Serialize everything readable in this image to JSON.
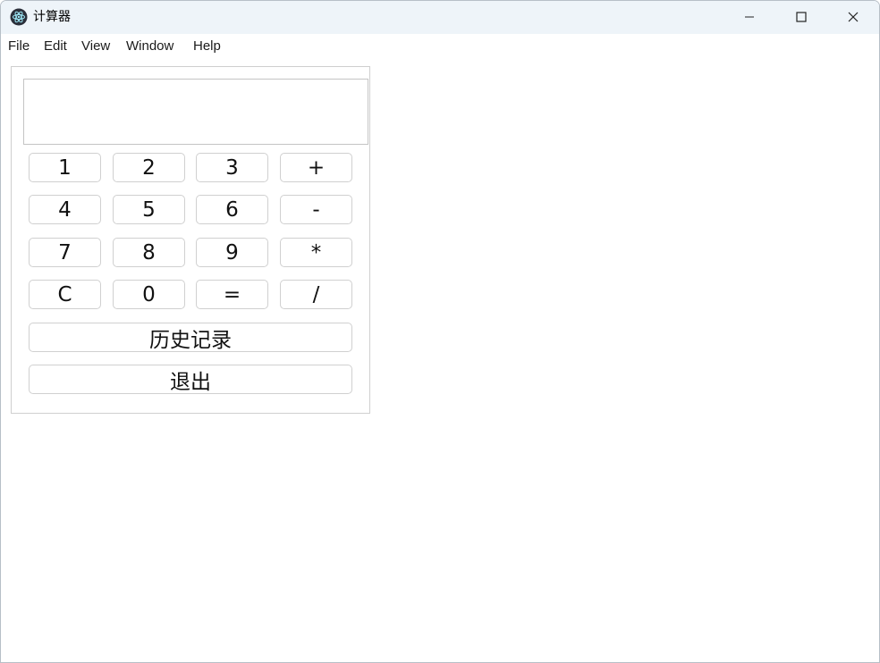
{
  "window": {
    "title": "计算器",
    "app_icon": "electron-atom-icon",
    "controls": {
      "minimize_icon": "minimize-icon",
      "maximize_icon": "maximize-icon",
      "close_icon": "close-icon"
    }
  },
  "menu": {
    "items": [
      "File",
      "Edit",
      "View",
      "Window",
      "Help"
    ]
  },
  "calculator": {
    "display_value": "",
    "rows": [
      [
        "1",
        "2",
        "3",
        "+"
      ],
      [
        "4",
        "5",
        "6",
        "-"
      ],
      [
        "7",
        "8",
        "9",
        "*"
      ],
      [
        "C",
        "0",
        "=",
        "/"
      ]
    ],
    "history_label": "历史记录",
    "exit_label": "退出"
  }
}
